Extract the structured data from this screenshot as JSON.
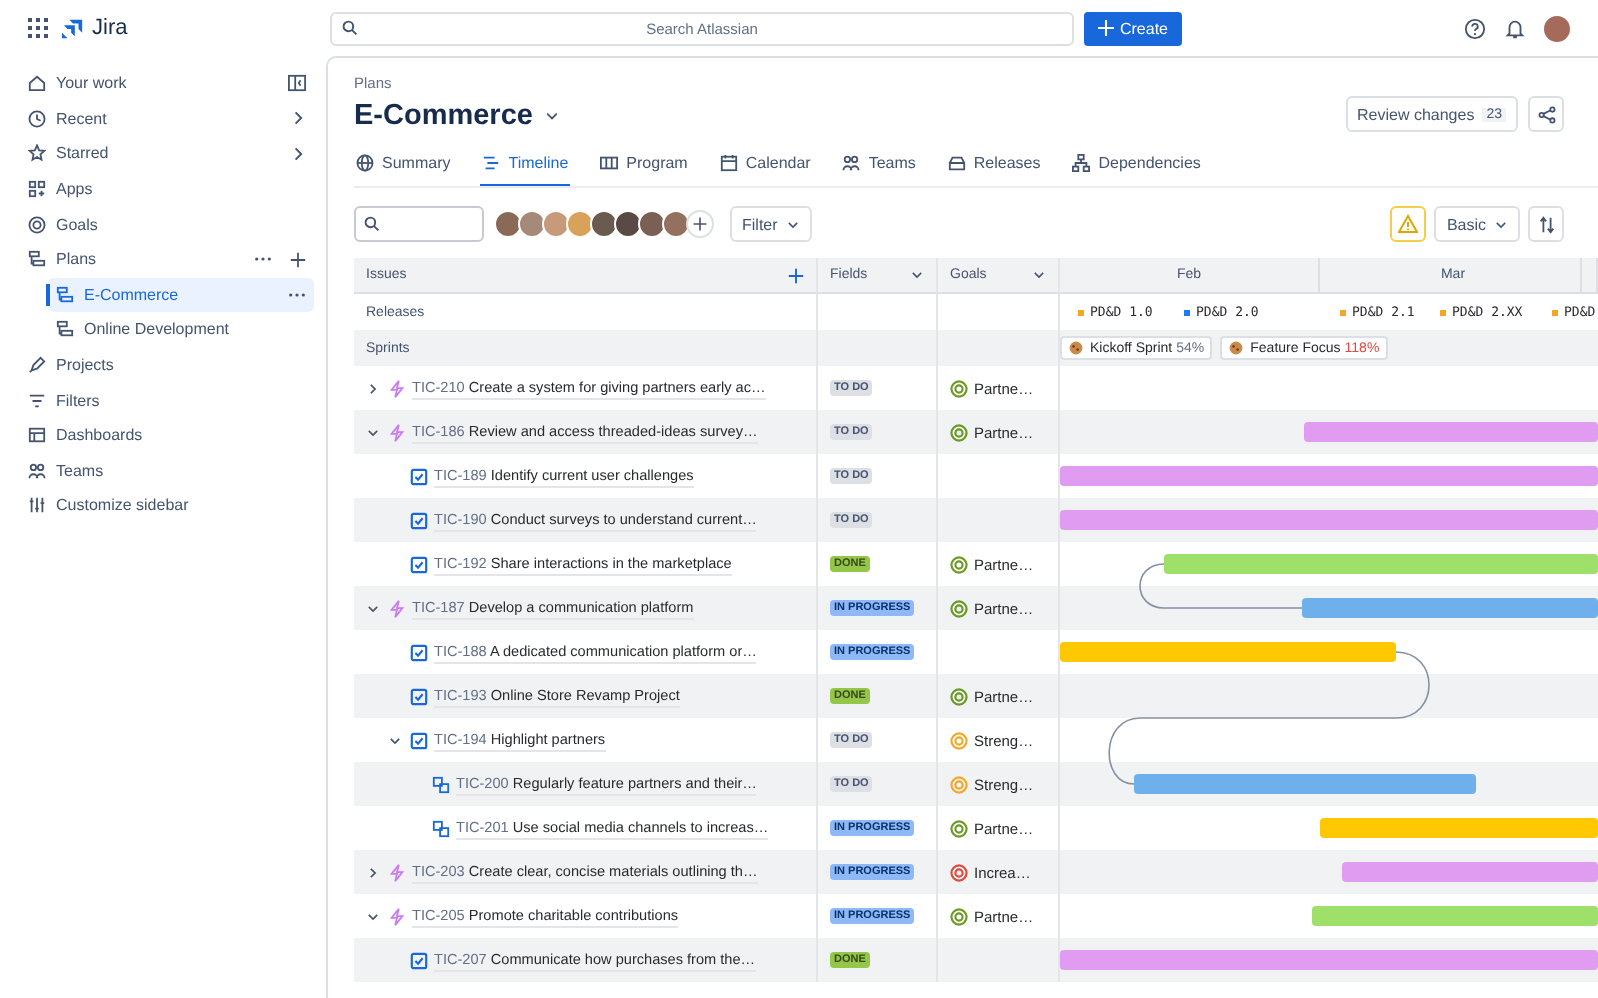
{
  "topbar": {
    "product": "Jira",
    "search": {
      "placeholder": "Search Atlassian"
    },
    "create_button": "Create"
  },
  "sidebar": {
    "collapse_button": true,
    "items": [
      {
        "label": "Your work",
        "selected": false
      },
      {
        "label": "Recent",
        "selected": false,
        "submenu": true
      },
      {
        "label": "Starred",
        "selected": false,
        "submenu": true
      },
      {
        "label": "Apps",
        "selected": false
      },
      {
        "label": "Goals",
        "selected": false
      },
      {
        "label": "Plans",
        "selected": false,
        "more": true,
        "add": true,
        "children": [
          {
            "label": "E-Commerce",
            "selected": true,
            "more": true
          },
          {
            "label": "Online Development",
            "selected": false
          }
        ]
      },
      {
        "label": "Projects",
        "selected": false
      },
      {
        "label": "Filters",
        "selected": false
      },
      {
        "label": "Dashboards",
        "selected": false
      },
      {
        "label": "Teams",
        "selected": false
      },
      {
        "label": "Customize sidebar",
        "selected": false
      }
    ]
  },
  "page": {
    "breadcrumb": "Plans",
    "title": "E-Commerce",
    "review_button": {
      "label": "Review changes",
      "count": "23"
    },
    "tabs": [
      {
        "label": "Summary",
        "selected": false
      },
      {
        "label": "Timeline",
        "selected": true
      },
      {
        "label": "Program",
        "selected": false
      },
      {
        "label": "Calendar",
        "selected": false
      },
      {
        "label": "Teams",
        "selected": false
      },
      {
        "label": "Releases",
        "selected": false
      },
      {
        "label": "Dependencies",
        "selected": false
      }
    ],
    "toolbar": {
      "filter": "Filter",
      "view": "Basic",
      "warning": true
    }
  },
  "timeline": {
    "columns": [
      "Issues",
      "Fields",
      "Goals"
    ],
    "months": [
      "Feb",
      "Mar"
    ],
    "releases_label": "Releases",
    "sprints_label": "Sprints",
    "releases": [
      {
        "name": "PD&D 1.0",
        "color": "#f5a623"
      },
      {
        "name": "PD&D 2.0",
        "color": "#1d7afc"
      },
      {
        "name": "PD&D 2.1",
        "color": "#f5a623"
      },
      {
        "name": "PD&D 2.XX",
        "color": "#f5a623"
      },
      {
        "name": "PD&D",
        "color": "#f5a623"
      }
    ],
    "sprints": [
      {
        "name": "Kickoff Sprint",
        "percent": "54%",
        "over_capacity": false
      },
      {
        "name": "Feature Focus",
        "percent": "118%",
        "over_capacity": true
      }
    ],
    "rows": [
      {
        "key": "TIC-210",
        "title": "Create a system for giving partners early ac…",
        "kind": "epic",
        "expanded": false,
        "status": {
          "label": "TO DO",
          "kind": "todo"
        },
        "goal": {
          "label": "Partne…",
          "color": "#6a9a23"
        }
      },
      {
        "key": "TIC-186",
        "title": "Review and access threaded-ideas survey…",
        "kind": "epic",
        "expanded": true,
        "status": {
          "label": "TO DO",
          "kind": "todo"
        },
        "goal": {
          "label": "Partne…",
          "color": "#6a9a23"
        },
        "bar": {
          "color": "#df9cf0"
        },
        "children": [
          {
            "key": "TIC-189",
            "title": "Identify current user challenges",
            "kind": "task",
            "status": {
              "label": "TO DO",
              "kind": "todo"
            },
            "bar": {
              "color": "#df9cf0"
            }
          },
          {
            "key": "TIC-190",
            "title": "Conduct surveys to understand current…",
            "kind": "task",
            "status": {
              "label": "TO DO",
              "kind": "todo"
            },
            "bar": {
              "color": "#df9cf0"
            }
          },
          {
            "key": "TIC-192",
            "title": "Share interactions in the marketplace",
            "kind": "task",
            "status": {
              "label": "DONE",
              "kind": "done"
            },
            "goal": {
              "label": "Partne…",
              "color": "#6a9a23"
            },
            "bar": {
              "color": "#9fe06a"
            }
          }
        ]
      },
      {
        "key": "TIC-187",
        "title": "Develop a communication platform",
        "kind": "epic",
        "expanded": true,
        "status": {
          "label": "IN PROGRESS",
          "kind": "inprogress"
        },
        "goal": {
          "label": "Partne…",
          "color": "#6a9a23"
        },
        "bar": {
          "color": "#6fb0ec"
        },
        "children": [
          {
            "key": "TIC-188",
            "title": "A dedicated communication platform or…",
            "kind": "task",
            "status": {
              "label": "IN PROGRESS",
              "kind": "inprogress"
            },
            "bar": {
              "color": "#ffc800"
            }
          },
          {
            "key": "TIC-193",
            "title": "Online Store Revamp Project",
            "kind": "task",
            "status": {
              "label": "DONE",
              "kind": "done"
            },
            "goal": {
              "label": "Partne…",
              "color": "#6a9a23"
            }
          },
          {
            "key": "TIC-194",
            "title": "Highlight partners",
            "kind": "task",
            "expanded": true,
            "status": {
              "label": "TO DO",
              "kind": "todo"
            },
            "goal": {
              "label": "Streng…",
              "color": "#f5a623"
            },
            "children": [
              {
                "key": "TIC-200",
                "title": "Regularly feature partners and their…",
                "kind": "subtask",
                "status": {
                  "label": "TO DO",
                  "kind": "todo"
                },
                "goal": {
                  "label": "Streng…",
                  "color": "#f5a623"
                },
                "bar": {
                  "color": "#6fb0ec"
                }
              },
              {
                "key": "TIC-201",
                "title": "Use social media channels to increas…",
                "kind": "subtask",
                "status": {
                  "label": "IN PROGRESS",
                  "kind": "inprogress"
                },
                "goal": {
                  "label": "Partne…",
                  "color": "#6a9a23"
                },
                "bar": {
                  "color": "#ffc800"
                }
              }
            ]
          }
        ]
      },
      {
        "key": "TIC-203",
        "title": "Create clear, concise materials outlining th…",
        "kind": "epic",
        "expanded": false,
        "status": {
          "label": "IN PROGRESS",
          "kind": "inprogress"
        },
        "goal": {
          "label": "Increa…",
          "color": "#e2483d"
        },
        "bar": {
          "color": "#df9cf0"
        }
      },
      {
        "key": "TIC-205",
        "title": "Promote charitable contributions",
        "kind": "epic",
        "expanded": true,
        "status": {
          "label": "IN PROGRESS",
          "kind": "inprogress"
        },
        "goal": {
          "label": "Partne…",
          "color": "#6a9a23"
        },
        "bar": {
          "color": "#9fe06a"
        },
        "children": [
          {
            "key": "TIC-207",
            "title": "Communicate how purchases from the…",
            "kind": "task",
            "status": {
              "label": "DONE",
              "kind": "done"
            },
            "bar": {
              "color": "#df9cf0"
            }
          }
        ]
      }
    ]
  }
}
